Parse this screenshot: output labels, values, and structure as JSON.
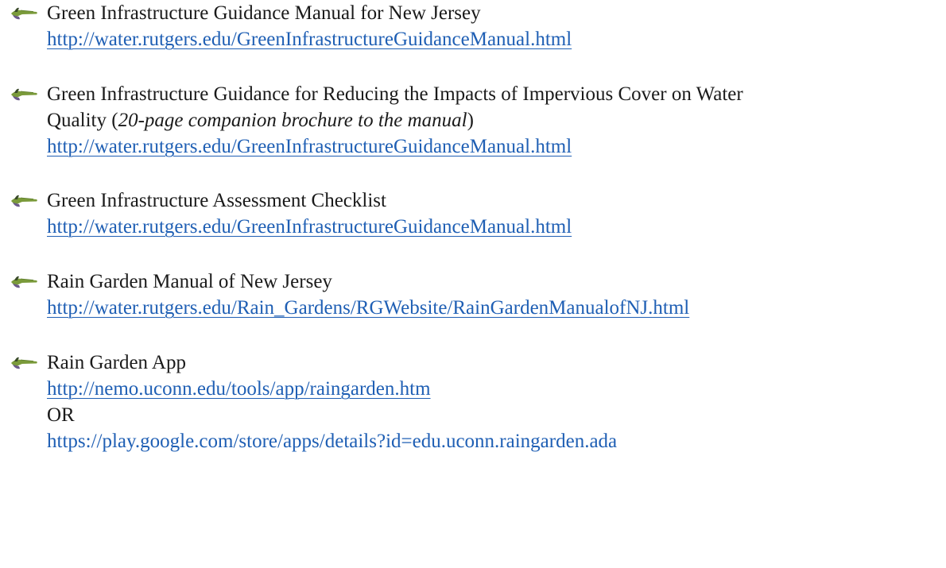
{
  "items": [
    {
      "icon": "hand-pointing-icon",
      "title": "Green Infrastructure Guidance Manual for New Jersey",
      "url": "http://water.rutgers.edu/GreenInfrastructureGuidanceManual.html"
    },
    {
      "icon": "hand-pointing-icon",
      "title_line1": "Green Infrastructure Guidance for Reducing the Impacts of Impervious Cover on Water",
      "title_line2_prefix": "Quality (",
      "title_line2_italic": "20-page companion brochure to the manual",
      "title_line2_suffix": ")",
      "url": "http://water.rutgers.edu/GreenInfrastructureGuidanceManual.html"
    },
    {
      "icon": "hand-pointing-icon",
      "title": "Green Infrastructure Assessment Checklist",
      "url": "http://water.rutgers.edu/GreenInfrastructureGuidanceManual.html"
    },
    {
      "icon": "hand-pointing-icon",
      "title": "Rain Garden Manual of New Jersey",
      "url": "http://water.rutgers.edu/Rain_Gardens/RGWebsite/RainGardenManualofNJ.html"
    },
    {
      "icon": "hand-pointing-icon",
      "title": "Rain Garden App",
      "url": "http://nemo.uconn.edu/tools/app/raingarden.htm",
      "separator": "OR",
      "url2": "https://play.google.com/store/apps/details?id=edu.uconn.raingarden.ada"
    }
  ],
  "colors": {
    "link": "#1f5fb4",
    "text": "#1a1a1a",
    "bullet_green": "#7a9a3a",
    "bullet_dark": "#3a4a2a"
  }
}
